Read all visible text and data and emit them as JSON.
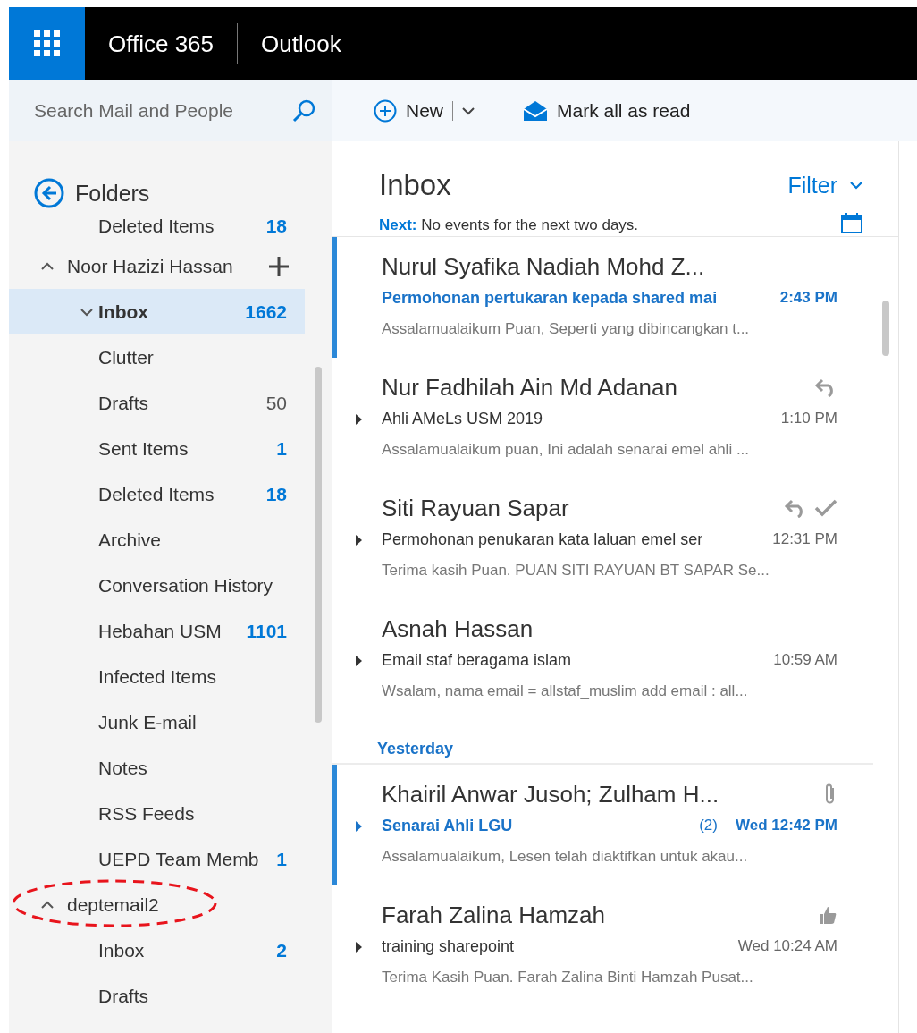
{
  "topbar": {
    "product": "Office 365",
    "app": "Outlook"
  },
  "search": {
    "placeholder": "Search Mail and People"
  },
  "toolbar": {
    "new_label": "New",
    "mark_all_label": "Mark all as read"
  },
  "sidebar": {
    "header": "Folders",
    "partial_folder": {
      "name": "Deleted Items",
      "count": "18",
      "unread": true
    },
    "accounts": [
      {
        "name": "Noor Hazizi Hassan",
        "expanded": true,
        "circled": false,
        "folders": [
          {
            "name": "Inbox",
            "count": "1662",
            "unread": true,
            "selected": true,
            "expanded": true
          },
          {
            "name": "Clutter",
            "selected": false
          },
          {
            "name": "Drafts",
            "count": "50",
            "unread": false,
            "selected": false
          },
          {
            "name": "Sent Items",
            "count": "1",
            "unread": true,
            "selected": false
          },
          {
            "name": "Deleted Items",
            "count": "18",
            "unread": true,
            "selected": false
          },
          {
            "name": "Archive",
            "selected": false
          },
          {
            "name": "Conversation History",
            "selected": false
          },
          {
            "name": "Hebahan USM",
            "count": "1101",
            "unread": true,
            "selected": false
          },
          {
            "name": "Infected Items",
            "selected": false
          },
          {
            "name": "Junk E-mail",
            "selected": false
          },
          {
            "name": "Notes",
            "selected": false
          },
          {
            "name": "RSS Feeds",
            "selected": false
          },
          {
            "name": "UEPD Team Memb",
            "count": "1",
            "unread": true,
            "selected": false
          }
        ]
      },
      {
        "name": "deptemail2",
        "expanded": true,
        "circled": true,
        "folders": [
          {
            "name": "Inbox",
            "count": "2",
            "unread": true,
            "selected": false
          },
          {
            "name": "Drafts",
            "selected": false
          }
        ]
      }
    ]
  },
  "list": {
    "title": "Inbox",
    "filter": "Filter",
    "next_label": "Next:",
    "next_text": "No events for the next two days.",
    "items": [
      {
        "kind": "message",
        "sender": "Nurul Syafika Nadiah Mohd Z...",
        "subject": "Permohonan pertukaran kepada shared mai",
        "time": "2:43 PM",
        "preview": "Assalamualaikum Puan,  Seperti yang dibincangkan t...",
        "unread": true,
        "thread": false,
        "replied": false,
        "done": false,
        "attachment": false,
        "liked": false
      },
      {
        "kind": "message",
        "sender": "Nur Fadhilah Ain Md Adanan",
        "subject": "Ahli AMeLs USM 2019",
        "time": "1:10 PM",
        "preview": "Assalamualaikum puan,  Ini adalah senarai emel ahli ...",
        "unread": false,
        "thread": true,
        "replied": true,
        "done": false,
        "attachment": false,
        "liked": false
      },
      {
        "kind": "message",
        "sender": "Siti Rayuan Sapar",
        "subject": "Permohonan penukaran kata laluan emel ser",
        "time": "12:31 PM",
        "preview": "Terima kasih Puan.   PUAN SITI RAYUAN BT SAPAR Se...",
        "unread": false,
        "thread": true,
        "replied": true,
        "done": true,
        "attachment": false,
        "liked": false
      },
      {
        "kind": "message",
        "sender": "Asnah Hassan",
        "subject": "Email staf beragama islam",
        "time": "10:59 AM",
        "preview": "Wsalam,  nama email = allstaf_muslim add email : all...",
        "unread": false,
        "thread": true,
        "replied": false,
        "done": false,
        "attachment": false,
        "liked": false
      },
      {
        "kind": "day",
        "label": "Yesterday"
      },
      {
        "kind": "message",
        "sender": "Khairil Anwar Jusoh; Zulham H...",
        "subject": "Senarai Ahli LGU",
        "count": "(2)",
        "time": "Wed 12:42 PM",
        "preview": "Assalamualaikum,  Lesen telah diaktifkan untuk akau...",
        "unread": true,
        "thread": true,
        "replied": false,
        "done": false,
        "attachment": true,
        "liked": false
      },
      {
        "kind": "message",
        "sender": "Farah Zalina Hamzah",
        "subject": "training sharepoint",
        "time": "Wed 10:24 AM",
        "preview": "Terima Kasih Puan.    Farah Zalina Binti Hamzah Pusat...",
        "unread": false,
        "thread": true,
        "replied": false,
        "done": false,
        "attachment": false,
        "liked": true
      }
    ]
  }
}
